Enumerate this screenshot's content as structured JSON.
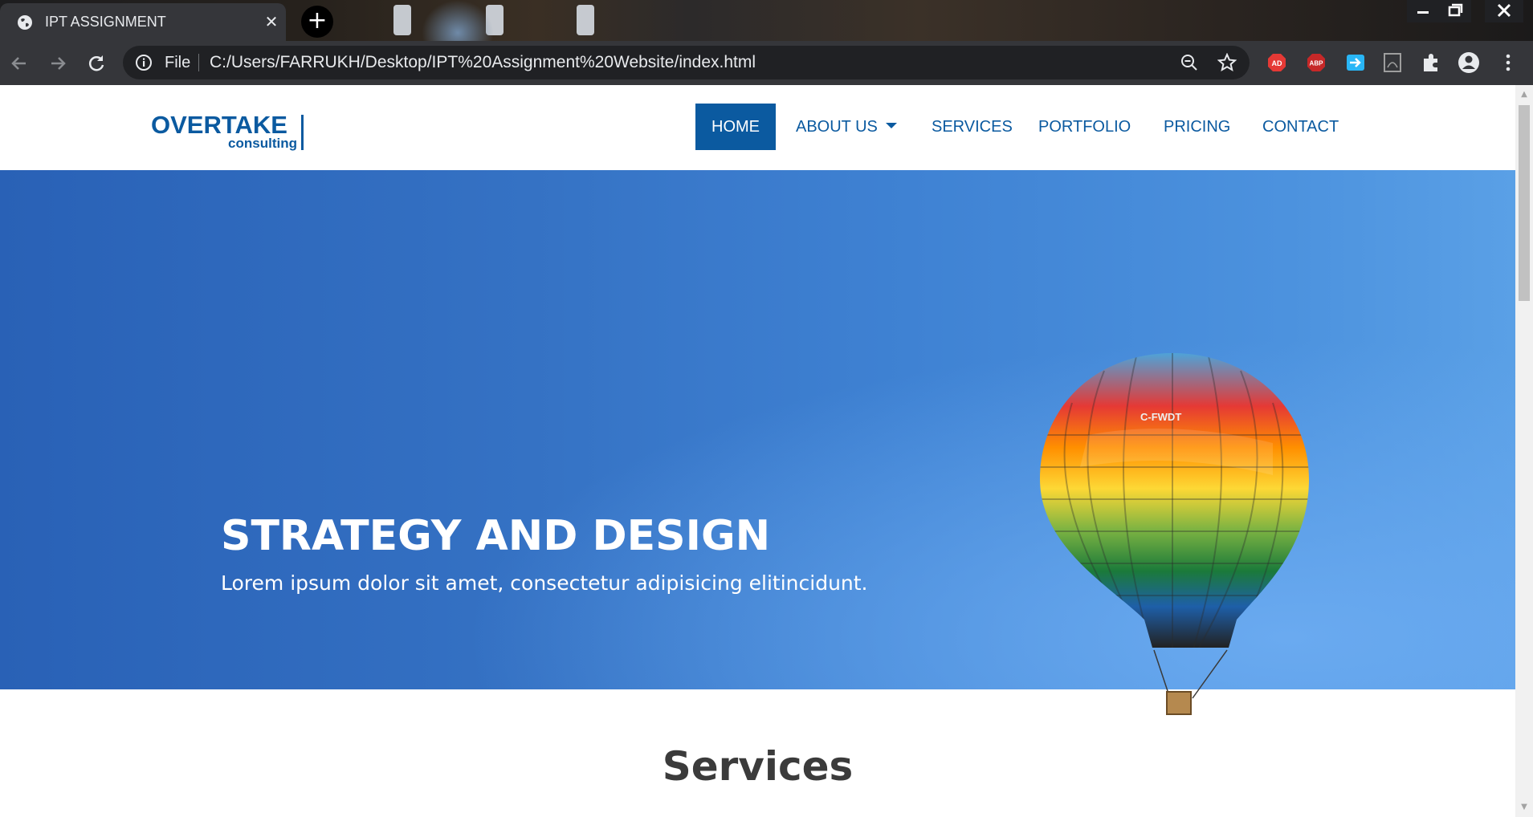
{
  "browser": {
    "tab_title": "IPT ASSIGNMENT",
    "new_tab_label": "+",
    "address_scheme": "File",
    "address_url": "C:/Users/FARRUKH/Desktop/IPT%20Assignment%20Website/index.html",
    "extensions": [
      {
        "name": "adblock-icon",
        "label": "AD",
        "color": "#e53935"
      },
      {
        "name": "abp-icon",
        "label": "ABP",
        "color": "#c62828"
      },
      {
        "name": "send-icon",
        "label": "",
        "color": "#29b6f6"
      },
      {
        "name": "pdf-icon",
        "label": "",
        "color": "#9e9e9e"
      },
      {
        "name": "puzzle-icon",
        "label": "",
        "color": "#e8eaed"
      },
      {
        "name": "profile-icon",
        "label": "",
        "color": "#e8eaed"
      }
    ]
  },
  "site": {
    "logo_main": "OVERTAKE",
    "logo_sub": "consulting",
    "nav": [
      {
        "label": "HOME",
        "active": true
      },
      {
        "label": "ABOUT US",
        "dropdown": true
      },
      {
        "label": "SERVICES"
      },
      {
        "label": "PORTFOLIO"
      },
      {
        "label": "PRICING"
      },
      {
        "label": "CONTACT"
      }
    ],
    "hero": {
      "title": "STRATEGY AND DESIGN",
      "subtitle": "Lorem ipsum dolor sit amet, consectetur adipisicing elitincidunt.",
      "balloon_marking": "C-FWDT"
    },
    "services_heading": "Services"
  },
  "colors": {
    "brand": "#0b5aa0",
    "hero_blue": "#3a7bcc",
    "browser_dark": "#35363a"
  }
}
